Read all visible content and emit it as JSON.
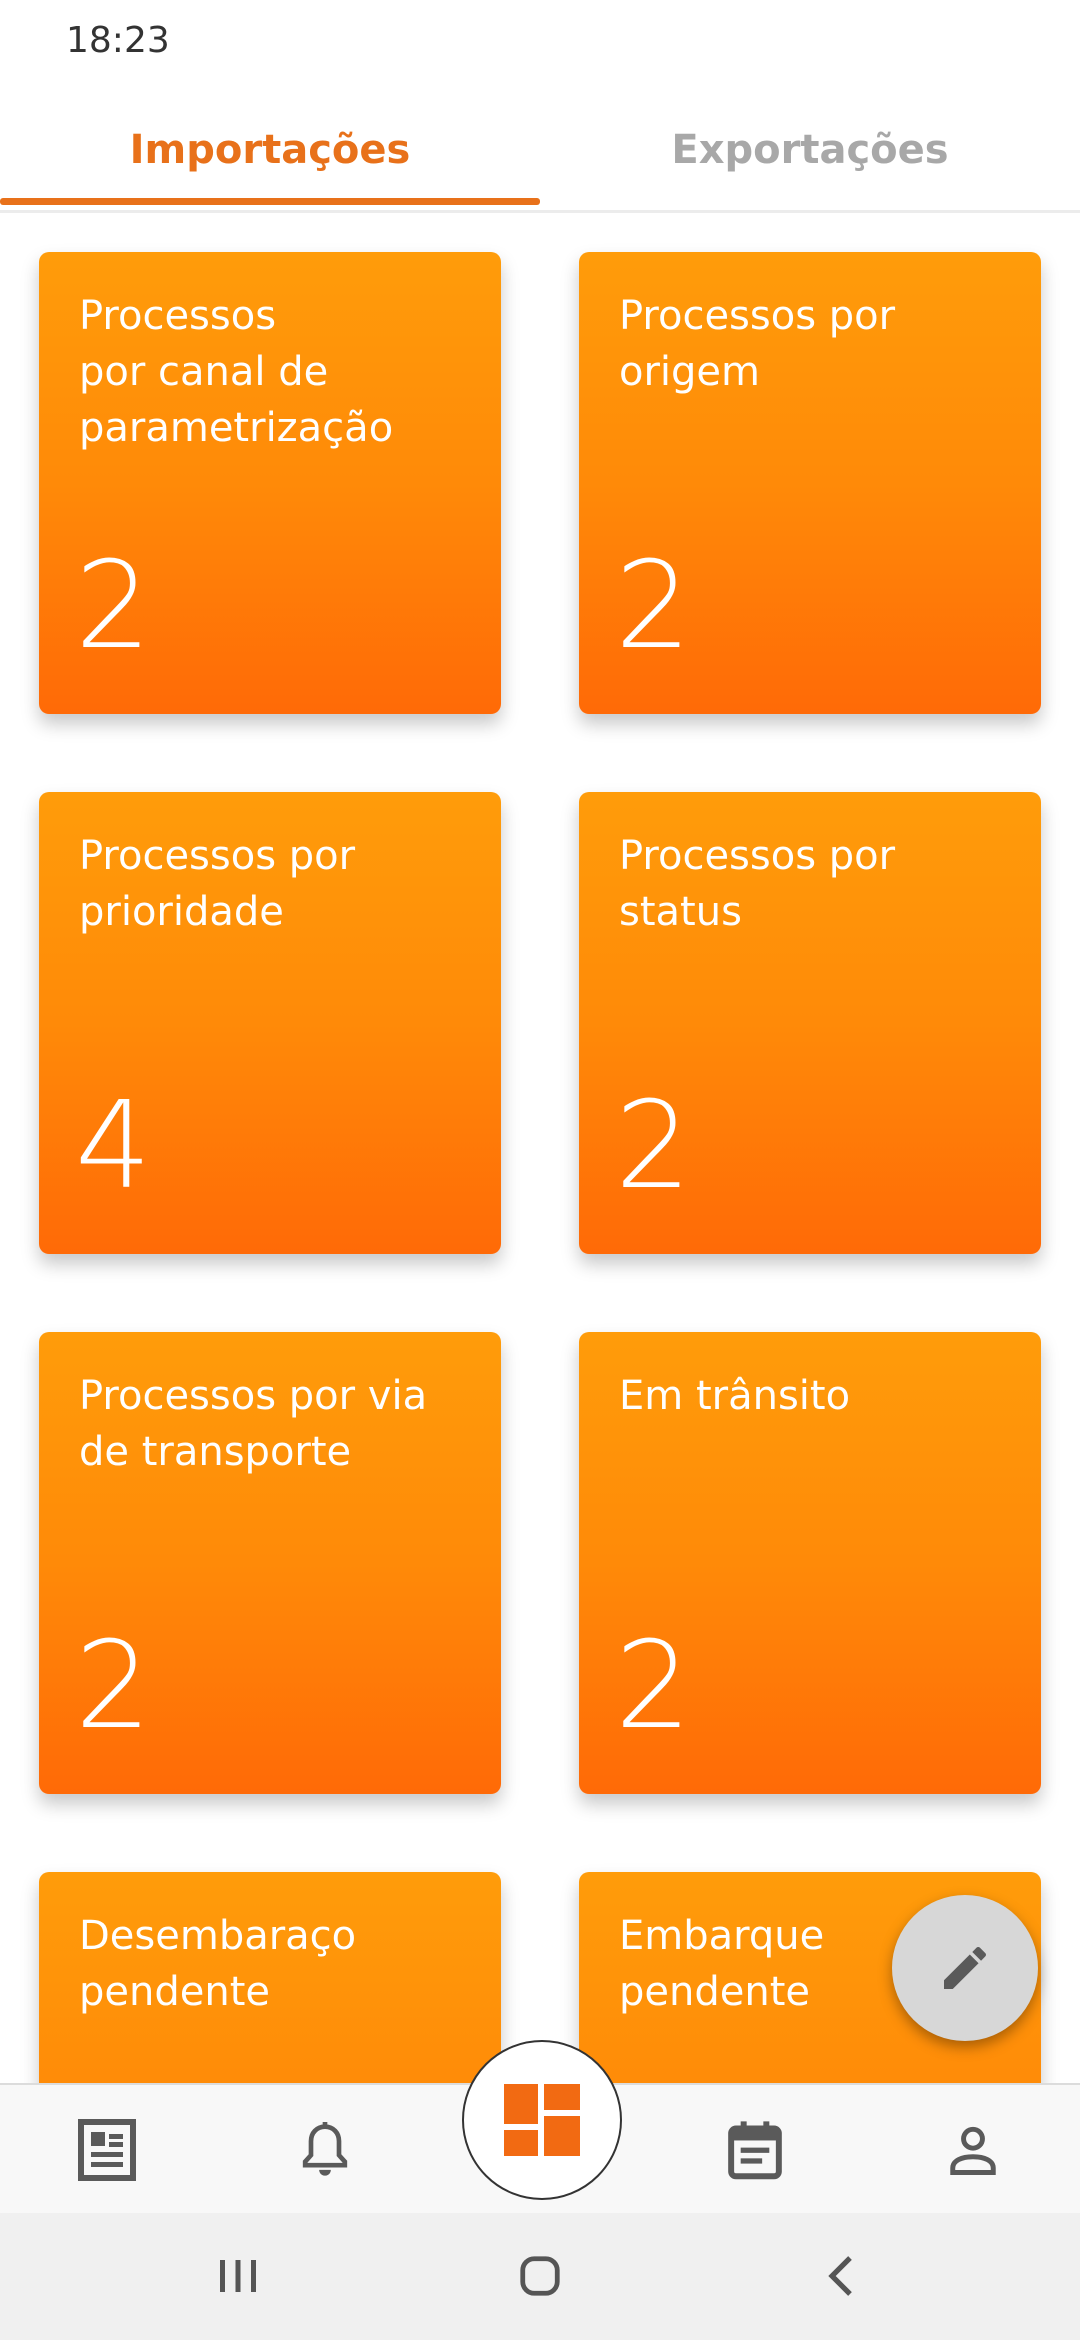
{
  "status": {
    "time": "18:23"
  },
  "tabs": [
    {
      "label": "Importações",
      "active": true
    },
    {
      "label": "Exportações",
      "active": false
    }
  ],
  "cards": [
    {
      "title": "Processos\npor canal de\nparametrização",
      "count": "2"
    },
    {
      "title": "Processos por\norigem",
      "count": "2"
    },
    {
      "title": "Processos por\nprioridade",
      "count": "4"
    },
    {
      "title": "Processos por\nstatus",
      "count": "2"
    },
    {
      "title": "Processos por via\nde transporte",
      "count": "2"
    },
    {
      "title": "Em trânsito",
      "count": "2"
    },
    {
      "title": "Desembaraço\npendente",
      "count": ""
    },
    {
      "title": "Embarque\npendente",
      "count": ""
    }
  ],
  "fab": {
    "icon": "pencil-icon"
  },
  "bottom_nav": {
    "items": [
      "document-icon",
      "bell-icon",
      "dashboard-icon",
      "calendar-icon",
      "person-icon"
    ],
    "active": "dashboard-icon"
  },
  "colors": {
    "accent": "#e8711a",
    "card_top": "#ff9c0a",
    "card_bottom": "#ff6a07",
    "inactive": "#a8a8a8"
  }
}
